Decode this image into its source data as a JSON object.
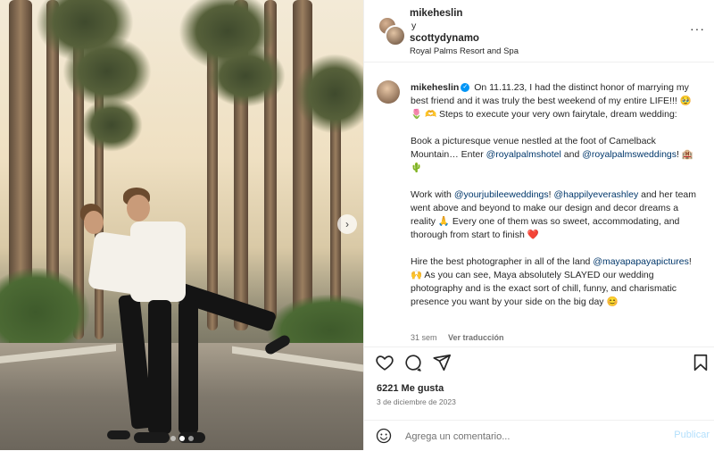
{
  "header": {
    "user1": "mikeheslin",
    "conjunction": "y",
    "user2": "scottydynamo",
    "location": "Royal Palms Resort and Spa",
    "more_label": "···"
  },
  "caption": {
    "username": "mikeheslin",
    "p1_text": " On 11.11.23, I had the distinct honor of marrying my best friend and it was truly the best weekend of my entire LIFE!!! 🥹 🌷 🫶 Steps to execute your very own fairytale, dream wedding:",
    "p2_text": "Book a picturesque venue nestled at the foot of Camelback Mountain… Enter ",
    "p2_mention1": "@royalpalmshotel",
    "p2_and": " and ",
    "p2_mention2": "@royalpalmsweddings",
    "p2_end": "! 🏨 🌵",
    "p3_start": "Work with ",
    "p3_mention1": "@yourjubileeweddings",
    "p3_mid": "! ",
    "p3_mention2": "@happilyeverashley",
    "p3_end": " and her team went above and beyond to make our design and decor dreams a reality 🙏 Every one of them was so sweet, accommodating, and thorough from start to finish ❤️",
    "p4_start": "Hire the best photographer in all of the land ",
    "p4_mention": "@mayapapayapictures",
    "p4_end": "! 🙌 As you can see, Maya absolutely SLAYED our wedding photography and is the exact sort of chill, funny, and charismatic presence you want by your side on the big day 😊",
    "time_ago": "31 sem",
    "translate_label": "Ver traducción"
  },
  "stats": {
    "likes": "6221 Me gusta",
    "date": "3 de diciembre de 2023"
  },
  "comment": {
    "placeholder": "Agrega un comentario...",
    "publish_label": "Publicar"
  },
  "carousel": {
    "next_label": "›",
    "total_slides": 3,
    "active_slide": 2
  },
  "colors": {
    "mention": "#00376b",
    "verified": "#0095f6",
    "muted": "#737373",
    "publish_disabled": "#b2dffc"
  },
  "icons": [
    "heart-icon",
    "comment-icon",
    "share-icon",
    "bookmark-icon",
    "emoji-icon",
    "verified-icon",
    "more-icon",
    "chevron-right-icon"
  ]
}
